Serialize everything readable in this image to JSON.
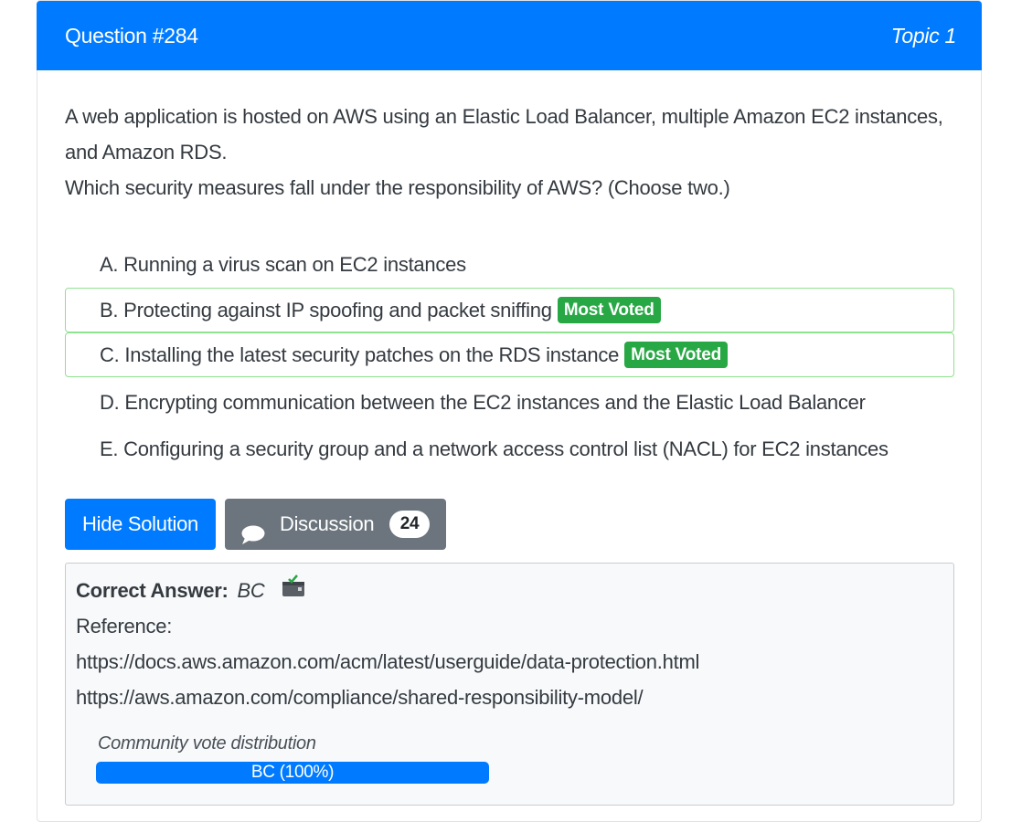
{
  "header": {
    "question": "Question #284",
    "topic": "Topic 1"
  },
  "question": {
    "line1": "A web application is hosted on AWS using an Elastic Load Balancer, multiple Amazon EC2 instances,",
    "line2": "and Amazon RDS.",
    "line3": "Which security measures fall under the responsibility of AWS? (Choose two.)"
  },
  "choices": [
    {
      "text": "A. Running a virus scan on EC2 instances",
      "voted": false
    },
    {
      "text": "B. Protecting against IP spoofing and packet sniffing",
      "voted": true,
      "badge": "Most Voted"
    },
    {
      "text": "C. Installing the latest security patches on the RDS instance",
      "voted": true,
      "badge": "Most Voted"
    },
    {
      "text": "D. Encrypting communication between the EC2 instances and the Elastic Load Balancer",
      "voted": false
    },
    {
      "text": "E. Configuring a security group and a network access control list (NACL) for EC2 instances",
      "voted": false
    }
  ],
  "buttons": {
    "hide_solution": "Hide Solution",
    "discussion": "Discussion",
    "discussion_count": "24"
  },
  "answer": {
    "label": "Correct Answer:",
    "value": "BC",
    "reference_label": "Reference:",
    "links": [
      "https://docs.aws.amazon.com/acm/latest/userguide/data-protection.html",
      "https://aws.amazon.com/compliance/shared-responsibility-model/"
    ]
  },
  "vote": {
    "title": "Community vote distribution",
    "bar_label": "BC (100%)",
    "percent": 100
  },
  "colors": {
    "primary": "#007bff",
    "secondary": "#6c757d",
    "success": "#28a745",
    "voted_border": "#8fe28f"
  },
  "icons": {
    "discussion": "speech-bubble-icon",
    "answer": "reveal-answer-icon"
  }
}
